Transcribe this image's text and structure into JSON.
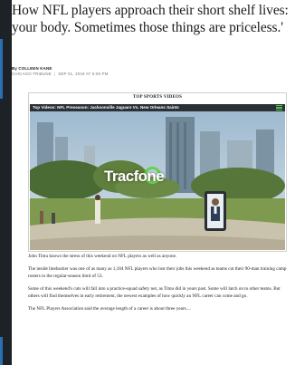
{
  "article": {
    "headline": "How NFL players approach their short shelf lives: your body. Sometimes those things are priceless.'",
    "byline": {
      "author": "By COLLEEN KANE",
      "outlet": "CHICAGO TRIBUNE",
      "date": "SEP 01, 2018 AT 5:00 PM"
    },
    "paragraphs": [
      "John Timu knows the stress of this weekend on NFL players as well as anyone.",
      "The inside linebacker was one of as many as 1,184 NFL players who lost their jobs this weekend as teams cut their 90-man training camp rosters to the regular-season limit of 53.",
      "Some of this weekend's cuts will fall into a practice-squad safety net, as Timu did in years past. Some will latch on to other teams. But others will find themselves in early retirement, the newest examples of how quickly an NFL career can come and go.",
      "The NFL Players Association said the average length of a career is about three years...."
    ]
  },
  "video": {
    "section_title": "TOP SPORTS VIDEOS",
    "player_title": "Top Videos: NFL Preseason: Jacksonville Jaguars Vs. New Orleans Saints",
    "overlay_logo": "Tracfone",
    "menu_icon": "hamburger-menu-icon"
  },
  "colors": {
    "page_background": "#ffffff",
    "frame_background": "#1d2227",
    "accent": "#2a6fb3",
    "player_menu_green": "#4fc84a",
    "logo_green": "#66d24c"
  }
}
